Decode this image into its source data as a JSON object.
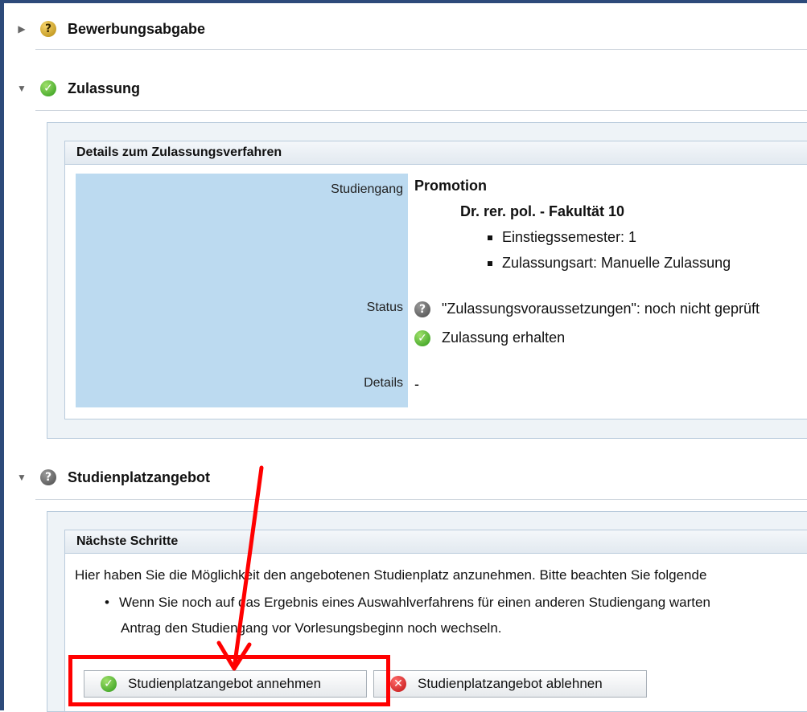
{
  "sections": [
    {
      "title": "Bewerbungsabgabe",
      "expanded": false,
      "status_icon": "question-gold-icon"
    },
    {
      "title": "Zulassung",
      "expanded": true,
      "status_icon": "check-green-icon"
    },
    {
      "title": "Studienplatzangebot",
      "expanded": true,
      "status_icon": "question-grey-icon"
    }
  ],
  "zulassung": {
    "panel_title": "Details zum Zulassungsverfahren",
    "labels": {
      "studiengang": "Studiengang",
      "status": "Status",
      "details": "Details"
    },
    "studiengang": "Promotion",
    "abschluss": "Dr. rer. pol. - Fakultät 10",
    "attributes": [
      "Einstiegssemester: 1",
      "Zulassungsart: Manuelle Zulassung"
    ],
    "status_items": [
      {
        "icon": "question-grey-icon",
        "text": "\"Zulassungsvoraussetzungen\": noch nicht geprüft"
      },
      {
        "icon": "check-green-icon",
        "text": "Zulassung erhalten"
      }
    ],
    "details_value": "-"
  },
  "studienplatz": {
    "panel_title": "Nächste Schritte",
    "intro": "Hier haben Sie die Möglichkeit den angebotenen Studienplatz anzunehmen. Bitte beachten Sie folgende",
    "bullet_line1": "Wenn Sie noch auf das Ergebnis eines Auswahlverfahrens für einen anderen Studiengang warten",
    "bullet_line2": "Antrag den Studiengang vor Vorlesungsbeginn noch wechseln.",
    "accept_label": "Studienplatzangebot annehmen",
    "reject_label": "Studienplatzangebot ablehnen"
  },
  "colors": {
    "highlight": "#ff0000",
    "label_bg": "#bcdaf0",
    "frame": "#2d4a7a"
  }
}
